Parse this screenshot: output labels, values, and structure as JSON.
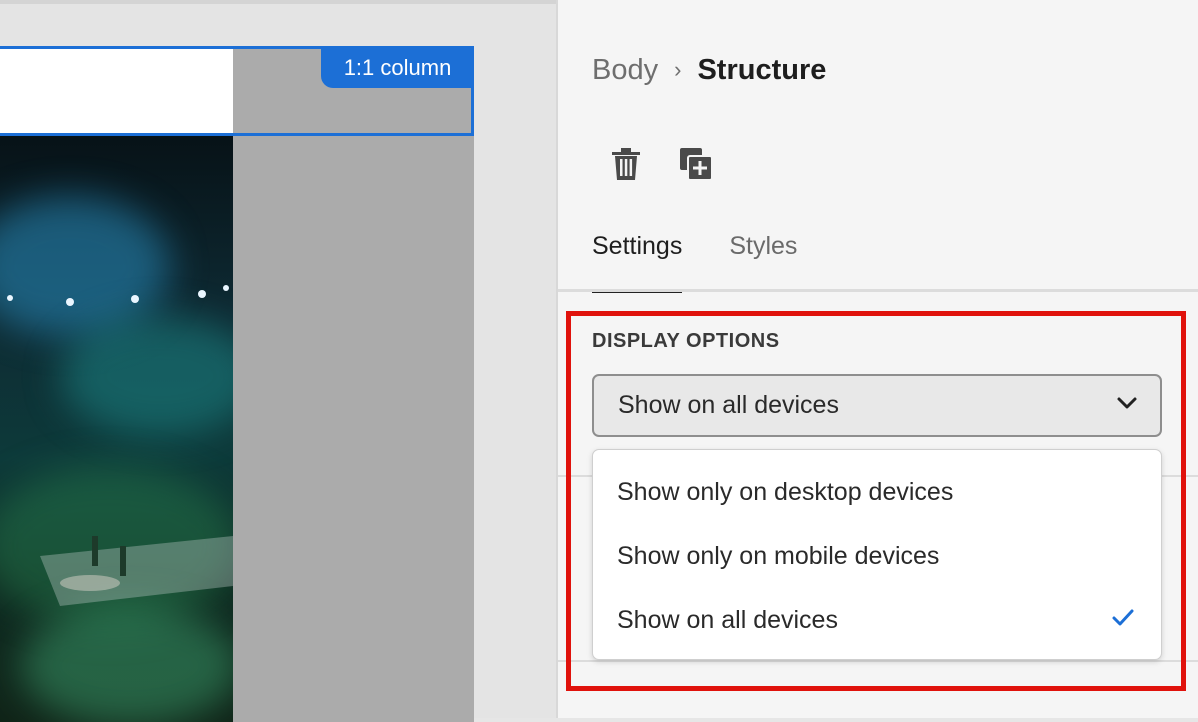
{
  "canvas": {
    "column_badge": "1:1 column"
  },
  "panel": {
    "breadcrumb": {
      "parent": "Body",
      "separator": "›",
      "current": "Structure"
    },
    "toolbar": {
      "delete_icon": "trash-icon",
      "duplicate_icon": "duplicate-icon"
    },
    "tabs": [
      {
        "label": "Settings",
        "active": true
      },
      {
        "label": "Styles",
        "active": false
      }
    ],
    "display_options": {
      "label": "DISPLAY OPTIONS",
      "selected": "Show on all devices",
      "options": [
        {
          "label": "Show only on desktop devices",
          "checked": false
        },
        {
          "label": "Show only on mobile devices",
          "checked": false
        },
        {
          "label": "Show on all devices",
          "checked": true
        }
      ]
    }
  },
  "colors": {
    "accent": "#1c6fd6",
    "highlight": "#e0120c",
    "check": "#1c6fd6"
  }
}
